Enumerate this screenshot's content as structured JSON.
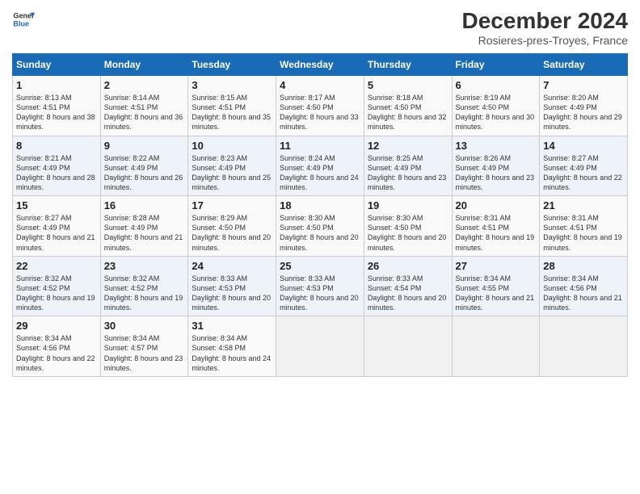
{
  "header": {
    "logo_line1": "General",
    "logo_line2": "Blue",
    "month": "December 2024",
    "location": "Rosieres-pres-Troyes, France"
  },
  "days_of_week": [
    "Sunday",
    "Monday",
    "Tuesday",
    "Wednesday",
    "Thursday",
    "Friday",
    "Saturday"
  ],
  "weeks": [
    [
      {
        "day": "1",
        "sunrise": "8:13 AM",
        "sunset": "4:51 PM",
        "daylight": "8 hours and 38 minutes."
      },
      {
        "day": "2",
        "sunrise": "8:14 AM",
        "sunset": "4:51 PM",
        "daylight": "8 hours and 36 minutes."
      },
      {
        "day": "3",
        "sunrise": "8:15 AM",
        "sunset": "4:51 PM",
        "daylight": "8 hours and 35 minutes."
      },
      {
        "day": "4",
        "sunrise": "8:17 AM",
        "sunset": "4:50 PM",
        "daylight": "8 hours and 33 minutes."
      },
      {
        "day": "5",
        "sunrise": "8:18 AM",
        "sunset": "4:50 PM",
        "daylight": "8 hours and 32 minutes."
      },
      {
        "day": "6",
        "sunrise": "8:19 AM",
        "sunset": "4:50 PM",
        "daylight": "8 hours and 30 minutes."
      },
      {
        "day": "7",
        "sunrise": "8:20 AM",
        "sunset": "4:49 PM",
        "daylight": "8 hours and 29 minutes."
      }
    ],
    [
      {
        "day": "8",
        "sunrise": "8:21 AM",
        "sunset": "4:49 PM",
        "daylight": "8 hours and 28 minutes."
      },
      {
        "day": "9",
        "sunrise": "8:22 AM",
        "sunset": "4:49 PM",
        "daylight": "8 hours and 26 minutes."
      },
      {
        "day": "10",
        "sunrise": "8:23 AM",
        "sunset": "4:49 PM",
        "daylight": "8 hours and 25 minutes."
      },
      {
        "day": "11",
        "sunrise": "8:24 AM",
        "sunset": "4:49 PM",
        "daylight": "8 hours and 24 minutes."
      },
      {
        "day": "12",
        "sunrise": "8:25 AM",
        "sunset": "4:49 PM",
        "daylight": "8 hours and 23 minutes."
      },
      {
        "day": "13",
        "sunrise": "8:26 AM",
        "sunset": "4:49 PM",
        "daylight": "8 hours and 23 minutes."
      },
      {
        "day": "14",
        "sunrise": "8:27 AM",
        "sunset": "4:49 PM",
        "daylight": "8 hours and 22 minutes."
      }
    ],
    [
      {
        "day": "15",
        "sunrise": "8:27 AM",
        "sunset": "4:49 PM",
        "daylight": "8 hours and 21 minutes."
      },
      {
        "day": "16",
        "sunrise": "8:28 AM",
        "sunset": "4:49 PM",
        "daylight": "8 hours and 21 minutes."
      },
      {
        "day": "17",
        "sunrise": "8:29 AM",
        "sunset": "4:50 PM",
        "daylight": "8 hours and 20 minutes."
      },
      {
        "day": "18",
        "sunrise": "8:30 AM",
        "sunset": "4:50 PM",
        "daylight": "8 hours and 20 minutes."
      },
      {
        "day": "19",
        "sunrise": "8:30 AM",
        "sunset": "4:50 PM",
        "daylight": "8 hours and 20 minutes."
      },
      {
        "day": "20",
        "sunrise": "8:31 AM",
        "sunset": "4:51 PM",
        "daylight": "8 hours and 19 minutes."
      },
      {
        "day": "21",
        "sunrise": "8:31 AM",
        "sunset": "4:51 PM",
        "daylight": "8 hours and 19 minutes."
      }
    ],
    [
      {
        "day": "22",
        "sunrise": "8:32 AM",
        "sunset": "4:52 PM",
        "daylight": "8 hours and 19 minutes."
      },
      {
        "day": "23",
        "sunrise": "8:32 AM",
        "sunset": "4:52 PM",
        "daylight": "8 hours and 19 minutes."
      },
      {
        "day": "24",
        "sunrise": "8:33 AM",
        "sunset": "4:53 PM",
        "daylight": "8 hours and 20 minutes."
      },
      {
        "day": "25",
        "sunrise": "8:33 AM",
        "sunset": "4:53 PM",
        "daylight": "8 hours and 20 minutes."
      },
      {
        "day": "26",
        "sunrise": "8:33 AM",
        "sunset": "4:54 PM",
        "daylight": "8 hours and 20 minutes."
      },
      {
        "day": "27",
        "sunrise": "8:34 AM",
        "sunset": "4:55 PM",
        "daylight": "8 hours and 21 minutes."
      },
      {
        "day": "28",
        "sunrise": "8:34 AM",
        "sunset": "4:56 PM",
        "daylight": "8 hours and 21 minutes."
      }
    ],
    [
      {
        "day": "29",
        "sunrise": "8:34 AM",
        "sunset": "4:56 PM",
        "daylight": "8 hours and 22 minutes."
      },
      {
        "day": "30",
        "sunrise": "8:34 AM",
        "sunset": "4:57 PM",
        "daylight": "8 hours and 23 minutes."
      },
      {
        "day": "31",
        "sunrise": "8:34 AM",
        "sunset": "4:58 PM",
        "daylight": "8 hours and 24 minutes."
      },
      null,
      null,
      null,
      null
    ]
  ]
}
